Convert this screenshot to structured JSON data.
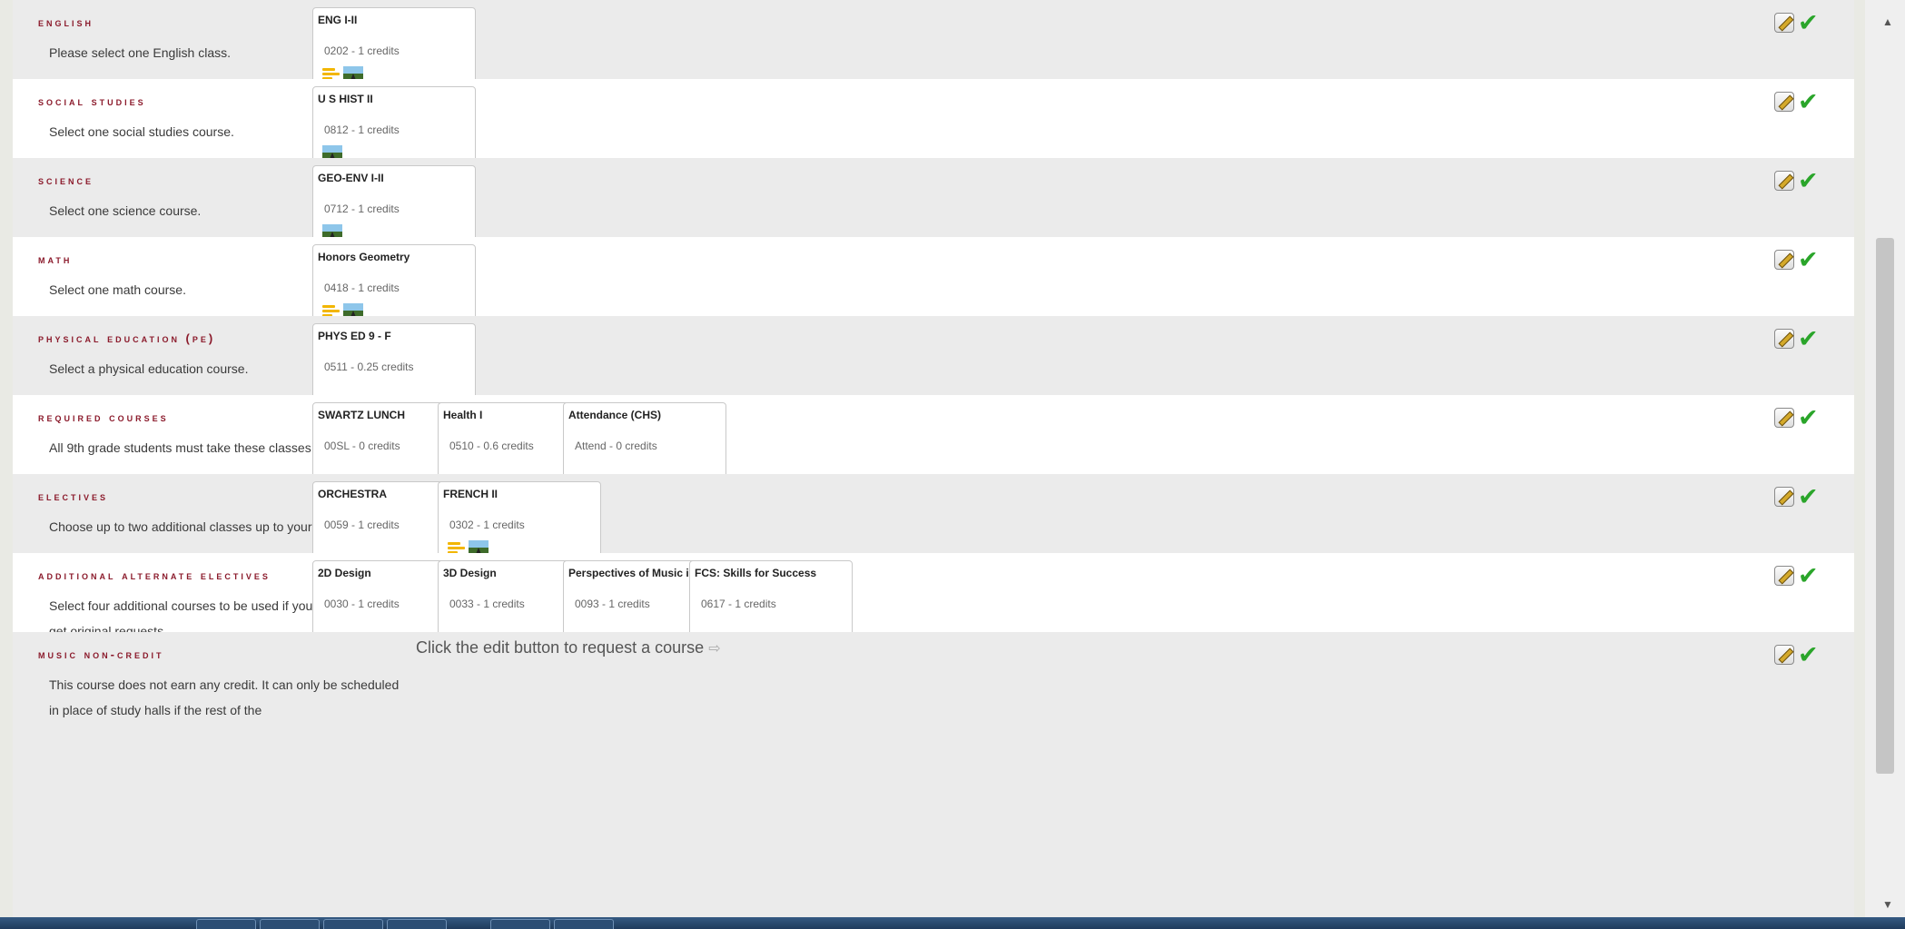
{
  "categories": [
    {
      "title": "English",
      "description": "Please select one English class.",
      "courses": [
        {
          "name": "ENG I-II",
          "detail": "0202 - 1 credits",
          "icons": [
            "note-icon",
            "road-icon"
          ]
        }
      ]
    },
    {
      "title": "Social Studies",
      "description": "Select one social studies course.",
      "courses": [
        {
          "name": "U S HIST II",
          "detail": "0812 - 1 credits",
          "icons": [
            "road-icon"
          ]
        }
      ]
    },
    {
      "title": "Science",
      "description": "Select one science course.",
      "courses": [
        {
          "name": "GEO-ENV I-II",
          "detail": "0712 - 1 credits",
          "icons": [
            "road-icon"
          ]
        }
      ]
    },
    {
      "title": "Math",
      "description": "Select one math course.",
      "courses": [
        {
          "name": "Honors Geometry",
          "detail": "0418 - 1 credits",
          "icons": [
            "note-icon",
            "road-icon"
          ]
        }
      ]
    },
    {
      "title": "Physical Education (PE)",
      "description": "Select a physical education course.",
      "courses": [
        {
          "name": "PHYS ED 9 - F",
          "detail": "0511 - 0.25 credits",
          "icons": []
        }
      ]
    },
    {
      "title": "Required Courses",
      "description": "All 9th grade students must take these classes.",
      "courses": [
        {
          "name": "SWARTZ LUNCH",
          "detail": "00SL - 0 credits",
          "icons": []
        },
        {
          "name": "Health I",
          "detail": "0510 - 0.6 credits",
          "icons": []
        },
        {
          "name": "Attendance (CHS)",
          "detail": "Attend - 0 credits",
          "icons": []
        }
      ]
    },
    {
      "title": "Electives",
      "description": "Choose up to two additional classes up to your seven credits.",
      "courses": [
        {
          "name": "ORCHESTRA",
          "detail": "0059 - 1 credits",
          "icons": []
        },
        {
          "name": "FRENCH II",
          "detail": "0302 - 1 credits",
          "icons": [
            "note-icon",
            "road-icon"
          ]
        }
      ]
    },
    {
      "title": "Additional Alternate Electives",
      "description": "Select four additional courses to be used if you are not able to get original requests.",
      "courses": [
        {
          "name": "2D Design",
          "detail": "0030 - 1 credits",
          "icons": []
        },
        {
          "name": "3D Design",
          "detail": "0033 - 1 credits",
          "icons": []
        },
        {
          "name": "Perspectives of Music in P",
          "detail": "0093 - 1 credits",
          "icons": []
        },
        {
          "name": "FCS: Skills for Success",
          "detail": "0617 - 1 credits",
          "icons": []
        }
      ]
    },
    {
      "title": "Music Non-Credit",
      "description": "This course does not earn any credit. It can only be scheduled in place of study halls if the rest of the",
      "hint": "Click the edit button to request a course",
      "hint_arrow": "⇨",
      "courses": []
    }
  ],
  "icons": {
    "edit": "edit-icon",
    "done": "check-icon",
    "check_glyph": "✔"
  },
  "colors": {
    "category_title": "#8b1a2b",
    "check": "#2aa52a",
    "row_alt": "#ebebeb"
  }
}
